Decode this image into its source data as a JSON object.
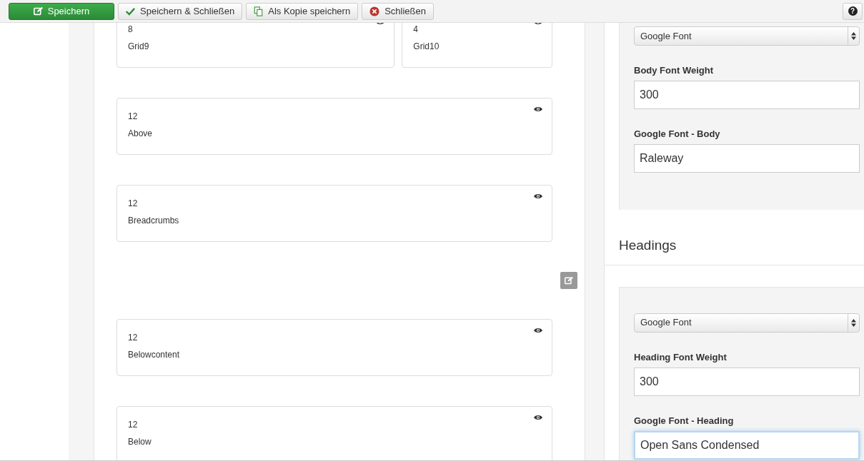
{
  "toolbar": {
    "buttons": [
      {
        "kind": "save",
        "label": "Speichern",
        "primary": true
      },
      {
        "kind": "save-close",
        "label": "Speichern & Schließen",
        "primary": false
      },
      {
        "kind": "copy",
        "label": "Als Kopie speichern",
        "primary": false
      },
      {
        "kind": "close",
        "label": "Schließen",
        "primary": false
      }
    ],
    "help_button": {
      "label": "?"
    }
  },
  "layout": {
    "items": [
      {
        "kind": "row",
        "cards": [
          {
            "size": "8",
            "name": "Grid9"
          },
          {
            "size": "4",
            "name": "Grid10"
          }
        ]
      },
      {
        "kind": "row",
        "cards": [
          {
            "size": "12",
            "name": "Above"
          }
        ]
      },
      {
        "kind": "row",
        "cards": [
          {
            "size": "12",
            "name": "Breadcrumbs"
          }
        ]
      },
      {
        "kind": "edit"
      },
      {
        "kind": "row",
        "cards": [
          {
            "size": "12",
            "name": "Belowcontent"
          }
        ]
      },
      {
        "kind": "row",
        "cards": [
          {
            "size": "12",
            "name": "Below"
          }
        ]
      }
    ]
  },
  "settings": {
    "groups": [
      {
        "select": "Google Font",
        "fields": [
          {
            "label": "Body Font Weight",
            "value": "300",
            "focused": false
          },
          {
            "label": "Google Font - Body",
            "value": "Raleway",
            "focused": false
          }
        ]
      },
      {
        "heading": "Headings",
        "select": "Google Font",
        "fields": [
          {
            "label": "Heading Font Weight",
            "value": "300",
            "focused": false
          },
          {
            "label": "Google Font - Heading",
            "value": "Open Sans Condensed",
            "focused": true
          }
        ]
      }
    ]
  }
}
